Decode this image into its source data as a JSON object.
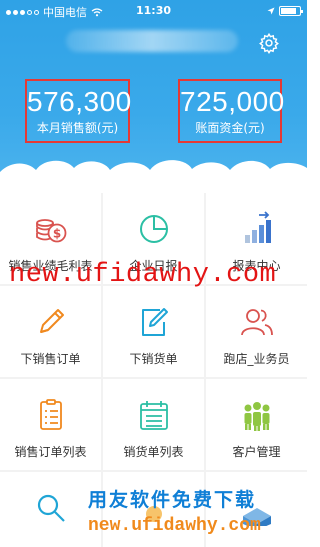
{
  "status_bar": {
    "carrier": "中国电信",
    "time": "11:30"
  },
  "header": {
    "settings_icon": "gear-icon",
    "stats": [
      {
        "value": "576,300",
        "label": "本月销售额(元)"
      },
      {
        "value": "725,000",
        "label": "账面资金(元)"
      }
    ],
    "highlight_color": "#e53935",
    "background_color": "#2fa2e6"
  },
  "menu": [
    {
      "label": "销售业绩毛利表",
      "icon": "coins-dollar-icon"
    },
    {
      "label": "企业日报",
      "icon": "pie-chart-icon"
    },
    {
      "label": "报表中心",
      "icon": "bar-chart-icon"
    },
    {
      "label": "下销售订单",
      "icon": "pencil-icon"
    },
    {
      "label": "下销货单",
      "icon": "edit-document-icon"
    },
    {
      "label": "跑店_业务员",
      "icon": "users-icon"
    },
    {
      "label": "销售订单列表",
      "icon": "clipboard-list-icon"
    },
    {
      "label": "销货单列表",
      "icon": "calendar-list-icon"
    },
    {
      "label": "客户管理",
      "icon": "customer-group-icon"
    },
    {
      "label": "",
      "icon": "search-icon"
    }
  ],
  "watermarks": {
    "top": "new.ufidawhy.com",
    "bottom_title": "用友软件免费下载",
    "bottom_url": "new.ufidawhy.com"
  }
}
